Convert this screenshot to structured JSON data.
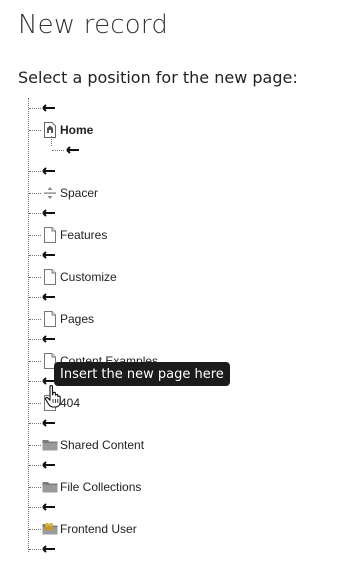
{
  "page": {
    "title": "New record",
    "subtitle": "Select a position for the new page:"
  },
  "tree": {
    "root_arrow": "insert-arrow",
    "home": {
      "label": "Home",
      "icon": "home-page-icon"
    },
    "items": [
      {
        "label": "Spacer",
        "icon": "spacer-icon"
      },
      {
        "label": "Features",
        "icon": "page-icon"
      },
      {
        "label": "Customize",
        "icon": "page-icon"
      },
      {
        "label": "Pages",
        "icon": "page-icon"
      },
      {
        "label": "Content Examples",
        "icon": "page-icon"
      },
      {
        "label": "404",
        "icon": "page-icon"
      },
      {
        "label": "Shared Content",
        "icon": "folder-icon"
      },
      {
        "label": "File Collections",
        "icon": "folder-icon"
      },
      {
        "label": "Frontend User",
        "icon": "user-folder-icon"
      }
    ]
  },
  "tooltip": {
    "text": "Insert the new page here"
  }
}
